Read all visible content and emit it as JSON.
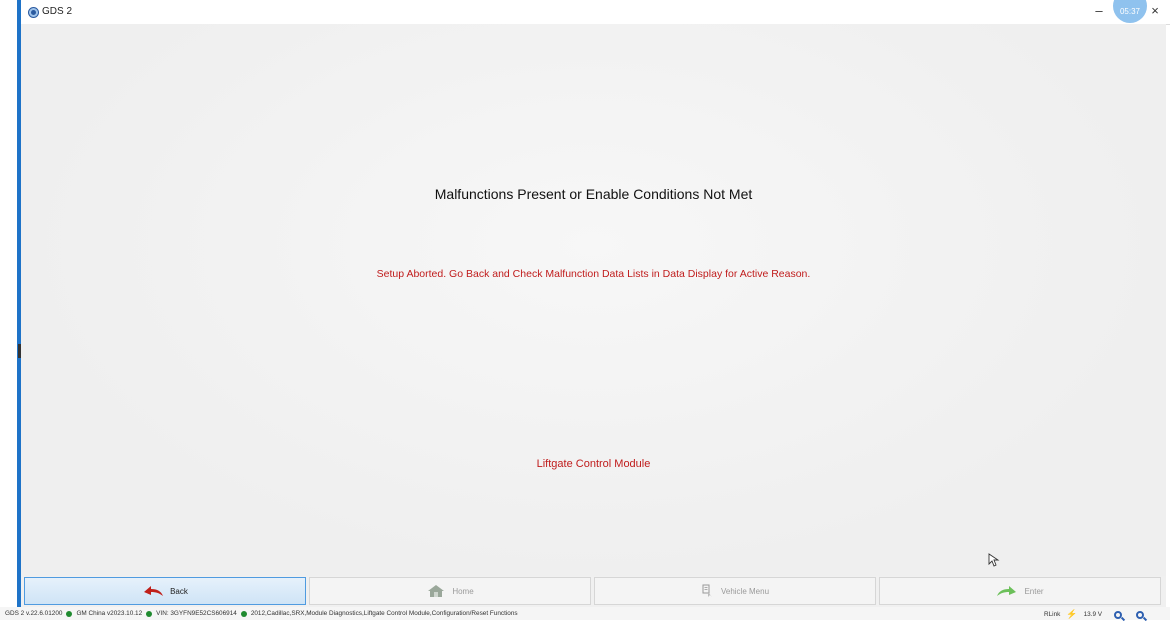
{
  "window": {
    "title": "GDS 2",
    "clock": "05:37",
    "minimize": "–",
    "close": "×"
  },
  "main": {
    "heading": "Malfunctions Present or Enable Conditions Not Met",
    "message": "Setup Aborted. Go Back and Check Malfunction Data Lists in Data Display for Active Reason.",
    "module": "Liftgate Control Module"
  },
  "buttons": {
    "back": "Back",
    "home": "Home",
    "vehicle_menu": "Vehicle Menu",
    "enter": "Enter"
  },
  "status": {
    "version": "GDS 2 v.22.6.01200",
    "database": "GM China v2023.10.12",
    "vin": "VIN: 3GYFN9E52CS606914",
    "path": "2012,Cadillac,SRX,Module Diagnostics,Liftgate Control Module,Configuration/Reset Functions",
    "link": "RLink",
    "voltage": "13.9 V"
  },
  "colors": {
    "accent": "#1e73c8",
    "error_text": "#c01c1c",
    "status_ok": "#1f8a2f"
  },
  "icons": [
    "app-icon",
    "back-arrow-icon",
    "home-icon",
    "vehicle-menu-icon",
    "enter-arrow-icon",
    "cursor-icon",
    "bolt-icon",
    "zoom-out-icon",
    "zoom-in-icon"
  ]
}
